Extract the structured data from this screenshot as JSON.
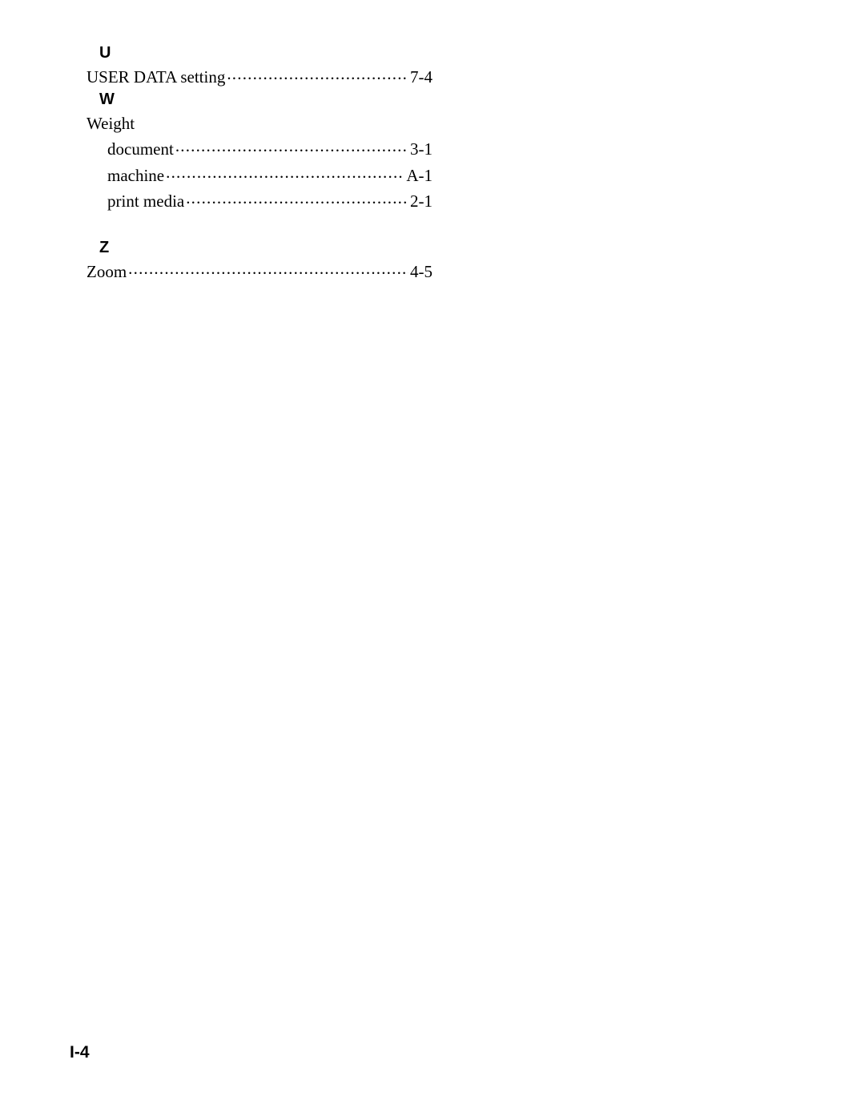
{
  "index": {
    "sections": [
      {
        "letter": "U",
        "entries": [
          {
            "term": "USER DATA setting",
            "page": "7-4",
            "sub": false
          }
        ]
      },
      {
        "letter": "W",
        "subheading": "Weight",
        "entries": [
          {
            "term": "document",
            "page": "3-1",
            "sub": true
          },
          {
            "term": "machine",
            "page": "A-1",
            "sub": true
          },
          {
            "term": "print media",
            "page": "2-1",
            "sub": true
          }
        ]
      },
      {
        "letter": "Z",
        "entries": [
          {
            "term": "Zoom",
            "page": "4-5",
            "sub": false
          }
        ]
      }
    ]
  },
  "page_number": "I-4"
}
